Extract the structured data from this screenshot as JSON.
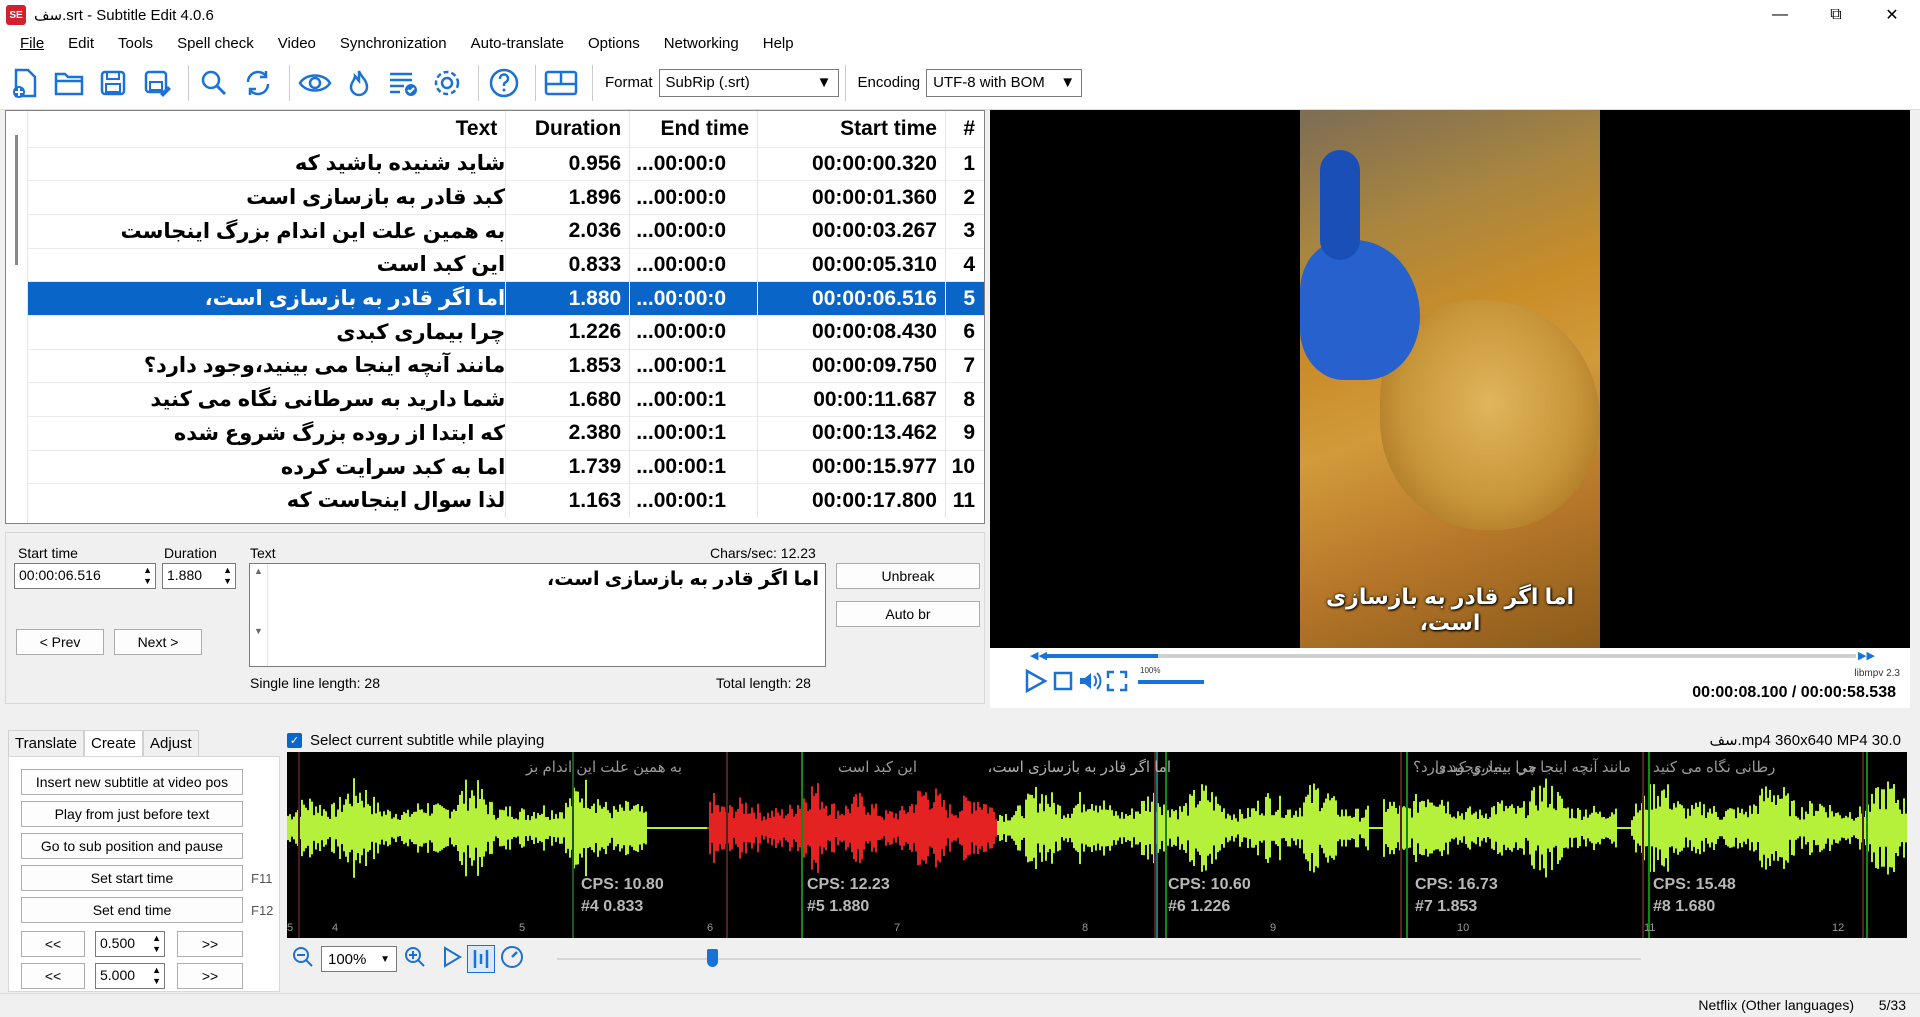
{
  "window": {
    "title": "سف.srt - Subtitle Edit 4.0.6",
    "app_icon_text": "SE"
  },
  "menu": [
    "File",
    "Edit",
    "Tools",
    "Spell check",
    "Video",
    "Synchronization",
    "Auto-translate",
    "Options",
    "Networking",
    "Help"
  ],
  "toolbar": {
    "format_label": "Format",
    "format_value": "SubRip (.srt)",
    "encoding_label": "Encoding",
    "encoding_value": "UTF-8 with BOM"
  },
  "grid": {
    "headers": {
      "text": "Text",
      "duration": "Duration",
      "end": "End time",
      "start": "Start time",
      "num": "#"
    },
    "rows": [
      {
        "num": "1",
        "start": "00:00:00.320",
        "end": "00:00:0...",
        "duration": "0.956",
        "text": "شاید شنیده باشید که"
      },
      {
        "num": "2",
        "start": "00:00:01.360",
        "end": "00:00:0...",
        "duration": "1.896",
        "text": "کبد قادر به بازسازی است"
      },
      {
        "num": "3",
        "start": "00:00:03.267",
        "end": "00:00:0...",
        "duration": "2.036",
        "text": "به همین علت این اندام بزرگ اینجاست"
      },
      {
        "num": "4",
        "start": "00:00:05.310",
        "end": "00:00:0...",
        "duration": "0.833",
        "text": "این کبد است"
      },
      {
        "num": "5",
        "start": "00:00:06.516",
        "end": "00:00:0...",
        "duration": "1.880",
        "text": "اما اگر قادر به بازسازی است،"
      },
      {
        "num": "6",
        "start": "00:00:08.430",
        "end": "00:00:0...",
        "duration": "1.226",
        "text": "چرا بیماری کبدی"
      },
      {
        "num": "7",
        "start": "00:00:09.750",
        "end": "00:00:1...",
        "duration": "1.853",
        "text": "مانند آنچه اینجا می بینید،وجود دارد؟"
      },
      {
        "num": "8",
        "start": "00:00:11.687",
        "end": "00:00:1...",
        "duration": "1.680",
        "text": "شما دارید به سرطانی نگاه می کنید"
      },
      {
        "num": "9",
        "start": "00:00:13.462",
        "end": "00:00:1...",
        "duration": "2.380",
        "text": "که ابتدا از روده بزرگ شروع شده"
      },
      {
        "num": "10",
        "start": "00:00:15.977",
        "end": "00:00:1...",
        "duration": "1.739",
        "text": "اما به کبد سرایت کرده"
      },
      {
        "num": "11",
        "start": "00:00:17.800",
        "end": "00:00:1...",
        "duration": "1.163",
        "text": "لذا سوال اینجاست که"
      }
    ]
  },
  "editor": {
    "start_label": "Start time",
    "start_value": "00:00:06.516",
    "duration_label": "Duration",
    "duration_value": "1.880",
    "text_label": "Text",
    "chars_sec": "Chars/sec: 12.23",
    "text_value": "اما اگر قادر به بازسازی است،",
    "unbreak": "Unbreak",
    "auto_br": "Auto br",
    "prev": "< Prev",
    "next": "Next >",
    "single_len": "Single line length: 28",
    "total_len": "Total length: 28"
  },
  "video": {
    "subtitle": "اما اگر قادر به بازسازی است،",
    "volume_label": "100%",
    "player": "libmpv 2.3",
    "timecode": "00:00:08.100 / 00:00:58.538",
    "position_fraction": 0.138
  },
  "tabs": [
    "Translate",
    "Create",
    "Adjust"
  ],
  "create": {
    "insert": "Insert new subtitle at video pos",
    "play_before": "Play from just before text",
    "goto_pause": "Go to sub position and pause",
    "set_start": "Set start time",
    "set_start_key": "F11",
    "set_end": "Set end time",
    "set_end_key": "F12",
    "back": "<<",
    "fwd": ">>",
    "step1": "0.500",
    "step2": "5.000"
  },
  "waveform": {
    "select_label": "Select current subtitle while playing",
    "file_info": "سف.mp4 360x640 MP4 30.0",
    "zoom": "100%",
    "texts": [
      "به همین علت این اندام بز",
      "این کبد است",
      "اما اگر قادر به بازسازی است،",
      "چرا بیماری کبدی",
      "مانند آنچه اینجا می بینید،وجود دارد؟",
      "رطانی نگاه می کنید"
    ],
    "cps": [
      {
        "cps": "CPS: 10.80",
        "info": "#4  0.833"
      },
      {
        "cps": "CPS: 12.23",
        "info": "#5  1.880"
      },
      {
        "cps": "CPS: 10.60",
        "info": "#6  1.226"
      },
      {
        "cps": "CPS: 16.73",
        "info": "#7  1.853"
      },
      {
        "cps": "CPS: 15.48",
        "info": "#8  1.680"
      }
    ],
    "ticks": [
      "5",
      "4",
      "5",
      "6",
      "7",
      "8",
      "9",
      "10",
      "11",
      "12"
    ]
  },
  "status": {
    "rule": "Netflix (Other languages)",
    "position": "5/33"
  },
  "colors": {
    "selection": "#0a65c8",
    "wave": "#b5f03a",
    "wave_selected": "#e52222"
  }
}
